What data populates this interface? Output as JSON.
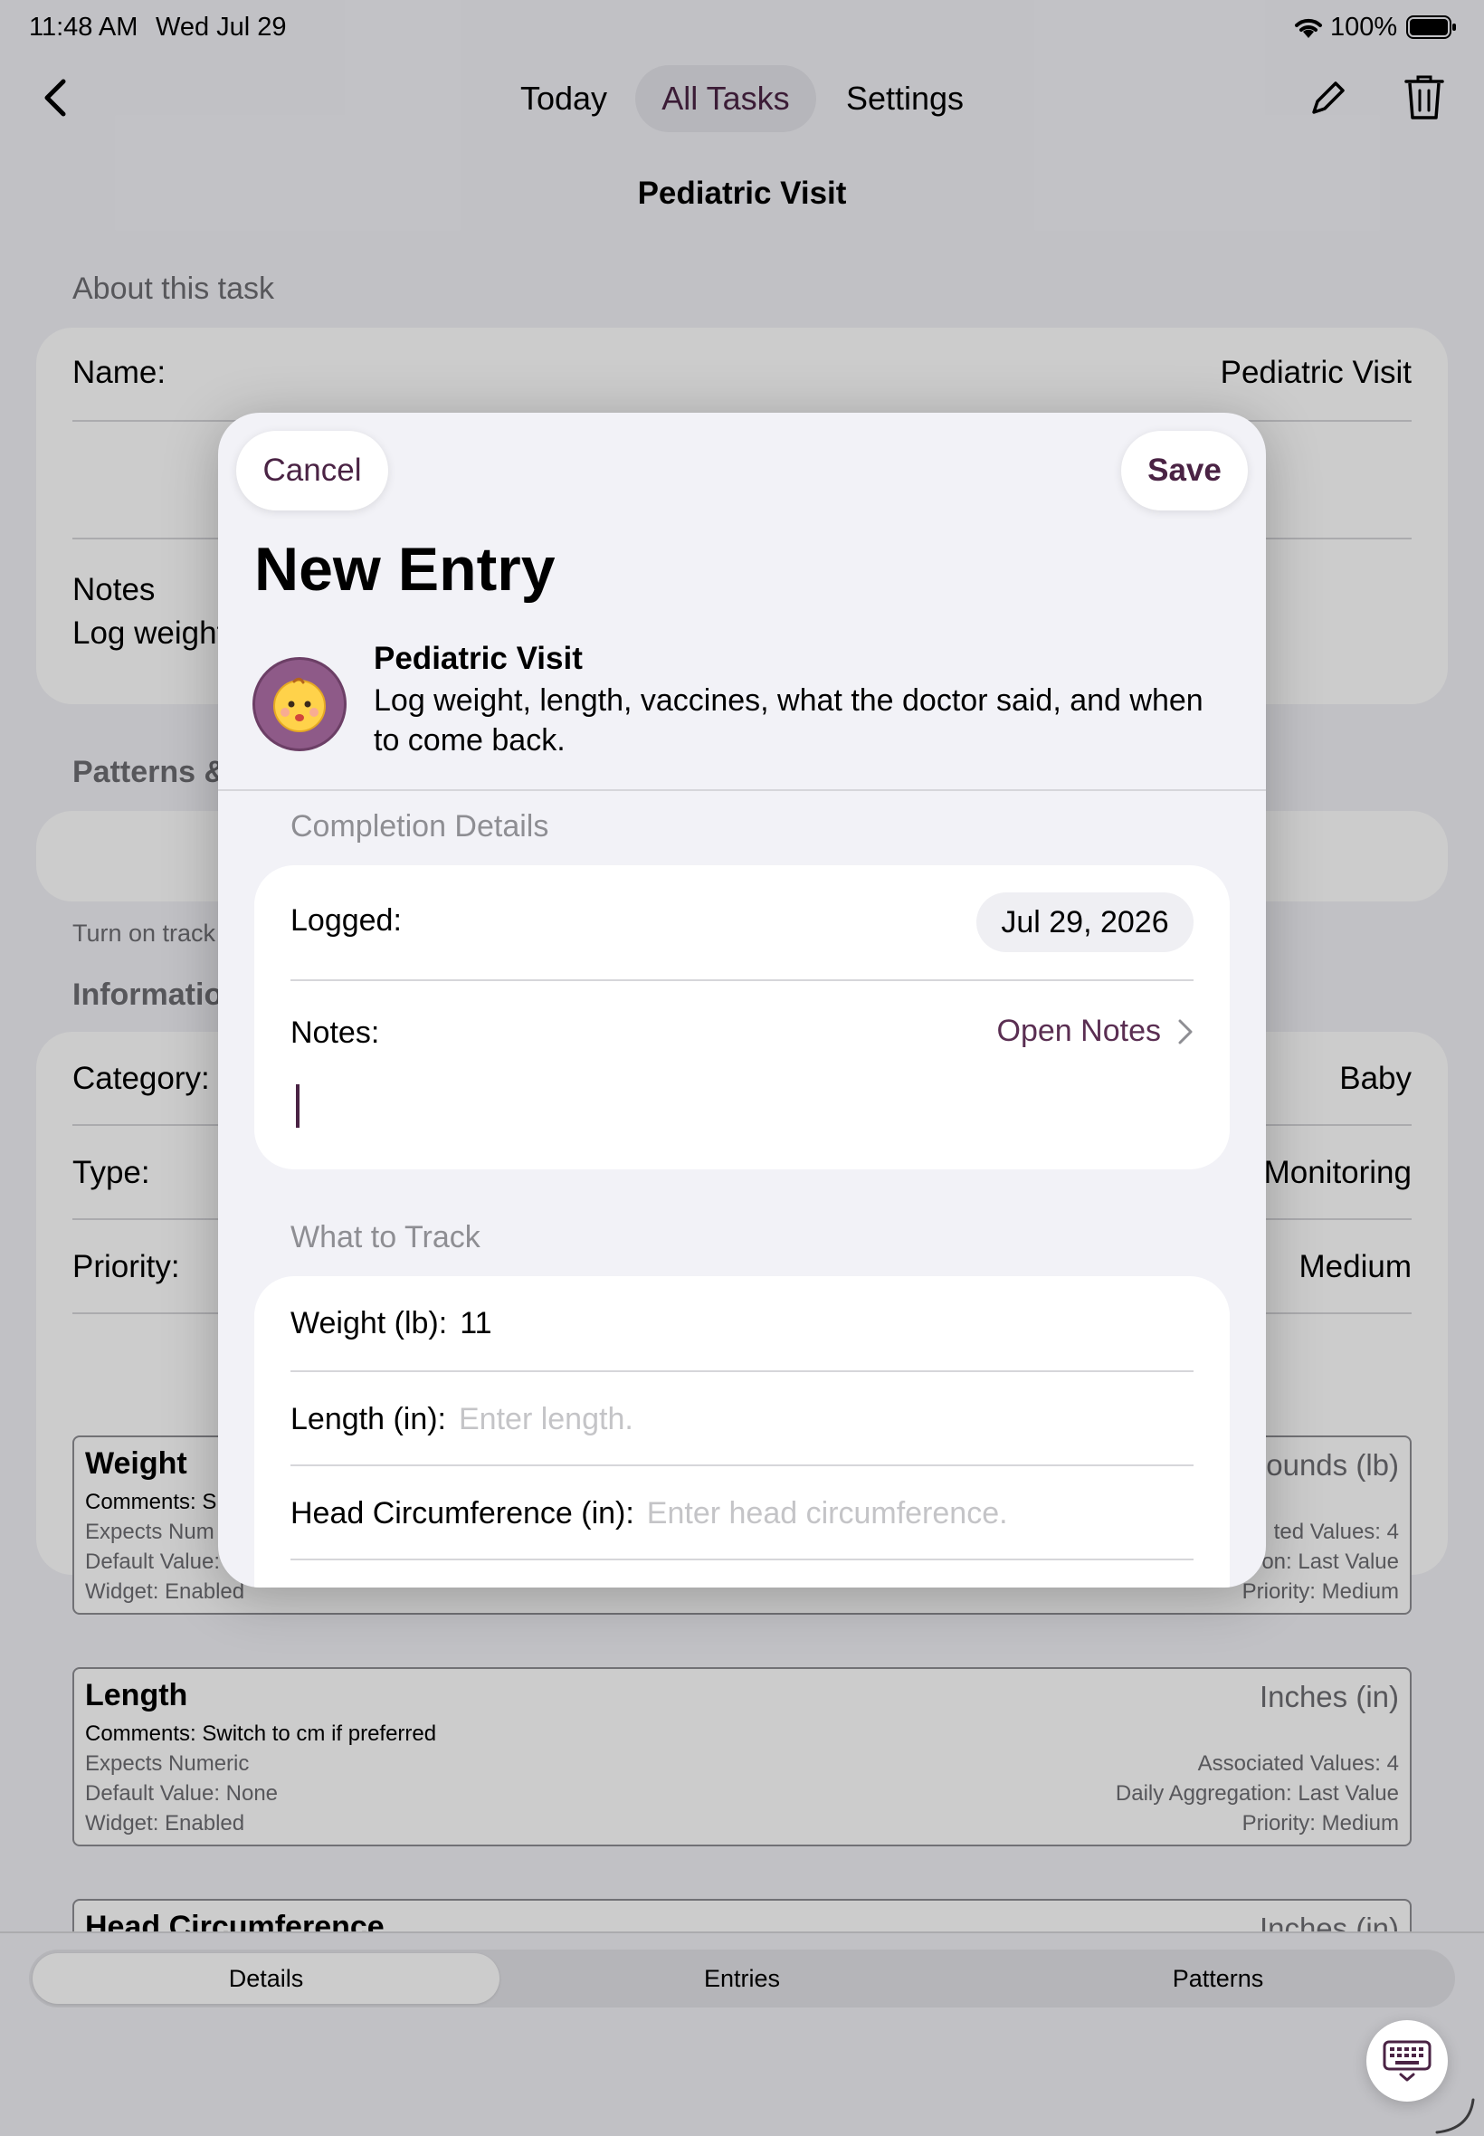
{
  "status_bar": {
    "time": "11:48 AM",
    "date": "Wed Jul 29",
    "battery": "100%"
  },
  "nav": {
    "tabs": [
      "Today",
      "All Tasks",
      "Settings"
    ],
    "selected_tab": "All Tasks",
    "page_title": "Pediatric Visit"
  },
  "about": {
    "header": "About this task",
    "name_label": "Name:",
    "name_value": "Pediatric Visit",
    "notes_label": "Notes",
    "notes_value": "Log weight"
  },
  "patterns": {
    "header": "Patterns &",
    "footnote": "Turn on track"
  },
  "information": {
    "header": "Informatio",
    "category_label": "Category:",
    "category_value": "Baby",
    "type_label": "Type:",
    "type_value": "Monitoring",
    "priority_label": "Priority:",
    "priority_value": "Medium"
  },
  "tracking_items": [
    {
      "title": "Weight",
      "unit": "ounds (lb)",
      "comment": "Comments: S",
      "meta_left": [
        "Expects Num",
        "Default Value:",
        "Widget: Enabled"
      ],
      "meta_right": [
        "ted Values: 4",
        "on: Last Value",
        "Priority: Medium"
      ]
    },
    {
      "title": "Length",
      "unit": "Inches (in)",
      "comment": "Comments: Switch to cm if preferred",
      "meta_left": [
        "Expects Numeric",
        "Default Value: None",
        "Widget: Enabled"
      ],
      "meta_right": [
        "Associated Values: 4",
        "Daily Aggregation: Last Value",
        "Priority: Medium"
      ]
    },
    {
      "title": "Head Circumference",
      "unit": "Inches (in)"
    }
  ],
  "bottom_tabs": {
    "items": [
      "Details",
      "Entries",
      "Patterns"
    ],
    "selected": "Details"
  },
  "modal": {
    "cancel_label": "Cancel",
    "save_label": "Save",
    "title": "New Entry",
    "task_name": "Pediatric Visit",
    "task_description": "Log weight, length, vaccines, what the doctor said, and when to come back.",
    "completion_header": "Completion Details",
    "logged_label": "Logged:",
    "logged_date": "Jul 29, 2026",
    "notes_label": "Notes:",
    "open_notes_label": "Open Notes",
    "track_header": "What to Track",
    "fields": [
      {
        "label": "Weight (lb):",
        "value": "11",
        "placeholder": ""
      },
      {
        "label": "Length (in):",
        "value": "",
        "placeholder": "Enter length."
      },
      {
        "label": "Head Circumference (in):",
        "value": "",
        "placeholder": "Enter head circumference."
      }
    ]
  },
  "colors": {
    "accent": "#4a2344",
    "avatar_bg": "#8e5a88"
  }
}
